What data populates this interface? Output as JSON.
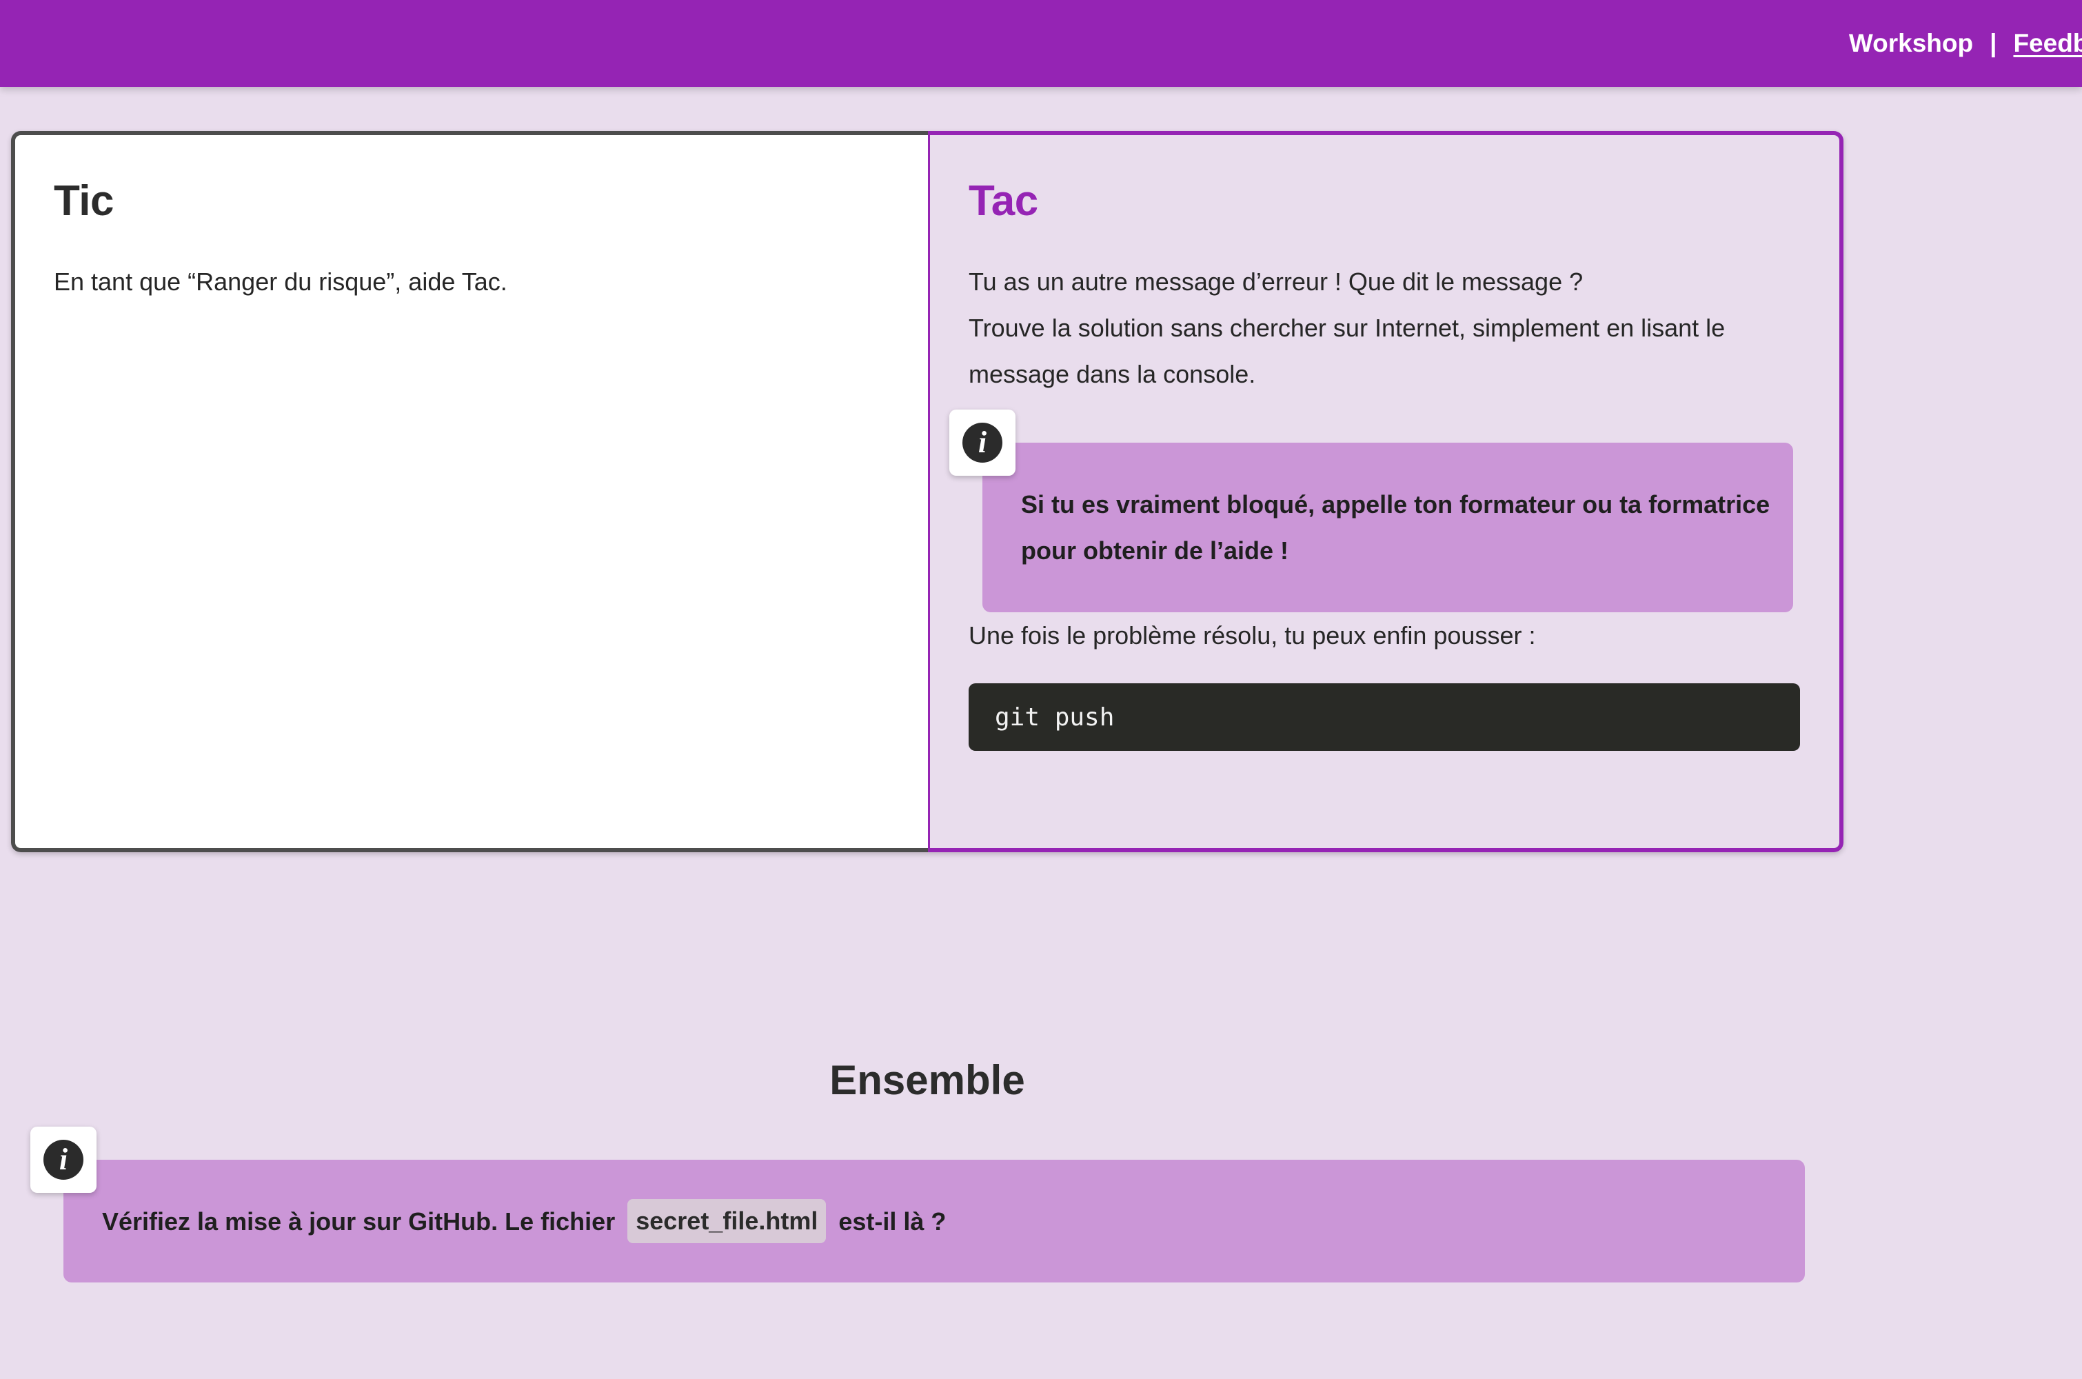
{
  "header": {
    "nav_workshop": "Workshop",
    "nav_separator": "|",
    "nav_feedback": "Feedba",
    "bg_color": "#9524b4"
  },
  "duo": {
    "left": {
      "title": "Tic",
      "text": "En tant que “Ranger du risque”, aide Tac."
    },
    "right": {
      "title": "Tac",
      "intro_line1": "Tu as un autre message d’erreur ! Que dit le message ?",
      "intro_line2": "Trouve la solution sans chercher sur Internet, simplement en lisant le message dans la console.",
      "note": "Si tu es vraiment bloqué, appelle ton formateur ou ta formatrice pour obtenir de l’aide !",
      "push_text": "Une fois le problème résolu, tu peux enfin pousser :",
      "code": "git push"
    }
  },
  "ensemble": {
    "title": "Ensemble",
    "note_before": "Vérifiez la mise à jour sur GitHub. Le fichier",
    "note_code": "secret_file.html",
    "note_after": "est-il là ?"
  },
  "icons": {
    "info": "info-icon",
    "info_glyph": "i"
  },
  "colors": {
    "accent": "#9524b4",
    "page_bg": "#e9dded",
    "note_bg": "#cb96d7",
    "code_bg": "#292a26"
  }
}
